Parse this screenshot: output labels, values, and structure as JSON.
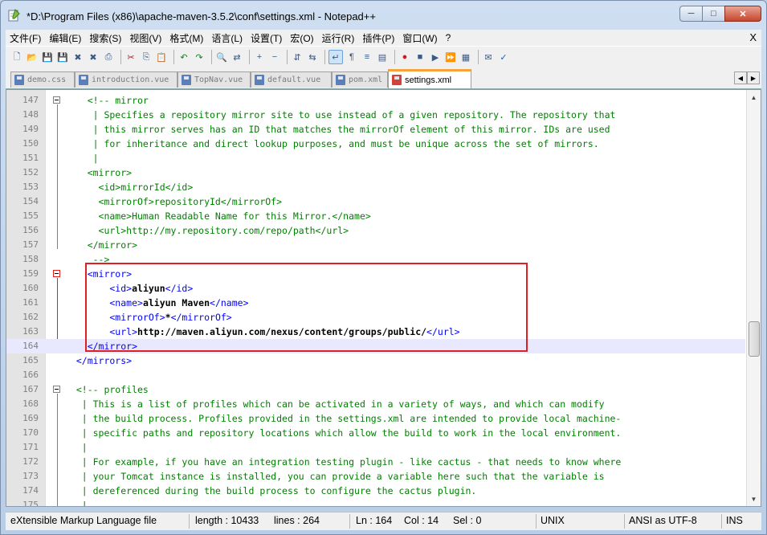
{
  "window": {
    "title": "*D:\\Program Files (x86)\\apache-maven-3.5.2\\conf\\settings.xml - Notepad++",
    "close_label": "X"
  },
  "menubar": {
    "items": [
      "文件(F)",
      "编辑(E)",
      "搜索(S)",
      "视图(V)",
      "格式(M)",
      "语言(L)",
      "设置(T)",
      "宏(O)",
      "运行(R)",
      "插件(P)",
      "窗口(W)",
      "?"
    ],
    "close_label": "X"
  },
  "toolbar": {
    "icons": [
      "new-file-icon",
      "open-file-icon",
      "save-icon",
      "save-all-icon",
      "close-icon",
      "close-all-icon",
      "print-icon",
      "cut-icon",
      "copy-icon",
      "paste-icon",
      "undo-icon",
      "redo-icon",
      "find-icon",
      "replace-icon",
      "zoom-in-icon",
      "zoom-out-icon",
      "sync-v-icon",
      "sync-h-icon",
      "word-wrap-icon",
      "show-all-chars-icon",
      "indent-guide-icon",
      "doc-map-icon",
      "record-macro-icon",
      "stop-macro-icon",
      "play-macro-icon",
      "run-macro-multiple-icon",
      "save-macro-icon",
      "launch-browser-icon",
      "spell-check-icon"
    ]
  },
  "tabs": [
    {
      "label": "demo.css",
      "active": false
    },
    {
      "label": "introduction.vue",
      "active": false
    },
    {
      "label": "TopNav.vue",
      "active": false
    },
    {
      "label": "default.vue",
      "active": false
    },
    {
      "label": "pom.xml",
      "active": false
    },
    {
      "label": "settings.xml",
      "active": true
    }
  ],
  "editor": {
    "current_line": "164",
    "lines": [
      {
        "n": "147",
        "segs": [
          {
            "t": "    <!-- mirror",
            "c": "cm"
          }
        ]
      },
      {
        "n": "148",
        "segs": [
          {
            "t": "     | Specifies a repository mirror site to use instead of a given repository. The repository that",
            "c": "cm"
          }
        ]
      },
      {
        "n": "149",
        "segs": [
          {
            "t": "     | this mirror serves has an ID that matches the mirrorOf element of this mirror. IDs are used",
            "c": "cm"
          }
        ]
      },
      {
        "n": "150",
        "segs": [
          {
            "t": "     | for inheritance and direct lookup purposes, and must be unique across the set of mirrors.",
            "c": "cm"
          }
        ]
      },
      {
        "n": "151",
        "segs": [
          {
            "t": "     |",
            "c": "cm"
          }
        ]
      },
      {
        "n": "152",
        "segs": [
          {
            "t": "    <mirror>",
            "c": "cm"
          }
        ]
      },
      {
        "n": "153",
        "segs": [
          {
            "t": "      <id>mirrorId</id>",
            "c": "cm"
          }
        ]
      },
      {
        "n": "154",
        "segs": [
          {
            "t": "      <mirrorOf>repositoryId</mirrorOf>",
            "c": "cm"
          }
        ]
      },
      {
        "n": "155",
        "segs": [
          {
            "t": "      <name>Human Readable Name for this Mirror.</name>",
            "c": "cm"
          }
        ]
      },
      {
        "n": "156",
        "segs": [
          {
            "t": "      <url>http://my.repository.com/repo/path</url>",
            "c": "cm"
          }
        ]
      },
      {
        "n": "157",
        "segs": [
          {
            "t": "    </mirror>",
            "c": "cm"
          }
        ]
      },
      {
        "n": "158",
        "segs": [
          {
            "t": "     -->",
            "c": "cm"
          }
        ]
      },
      {
        "n": "159",
        "segs": [
          {
            "t": "    <mirror>",
            "c": "tg"
          }
        ]
      },
      {
        "n": "160",
        "segs": [
          {
            "t": "        <id>",
            "c": "tg"
          },
          {
            "t": "aliyun",
            "c": "tx b"
          },
          {
            "t": "</id>",
            "c": "tg"
          }
        ]
      },
      {
        "n": "161",
        "segs": [
          {
            "t": "        <name>",
            "c": "tg"
          },
          {
            "t": "aliyun Maven",
            "c": "tx b"
          },
          {
            "t": "</name>",
            "c": "tg"
          }
        ]
      },
      {
        "n": "162",
        "segs": [
          {
            "t": "        <mirrorOf>",
            "c": "tg"
          },
          {
            "t": "*",
            "c": "tx b"
          },
          {
            "t": "</mirrorOf>",
            "c": "tg"
          }
        ]
      },
      {
        "n": "163",
        "segs": [
          {
            "t": "        <url>",
            "c": "tg"
          },
          {
            "t": "http://maven.aliyun.com/nexus/content/groups/public/",
            "c": "tx b"
          },
          {
            "t": "</url>",
            "c": "tg"
          }
        ]
      },
      {
        "n": "164",
        "segs": [
          {
            "t": "    </mirror>",
            "c": "tg"
          }
        ]
      },
      {
        "n": "165",
        "segs": [
          {
            "t": "  </mirrors>",
            "c": "tg"
          }
        ]
      },
      {
        "n": "166",
        "segs": [
          {
            "t": "",
            "c": "tx"
          }
        ]
      },
      {
        "n": "167",
        "segs": [
          {
            "t": "  <!-- profiles",
            "c": "cm"
          }
        ]
      },
      {
        "n": "168",
        "segs": [
          {
            "t": "   | This is a list of profiles which can be activated in a variety of ways, and which can modify",
            "c": "cm"
          }
        ]
      },
      {
        "n": "169",
        "segs": [
          {
            "t": "   | the build process. Profiles provided in the settings.xml are intended to provide local machine-",
            "c": "cm"
          }
        ]
      },
      {
        "n": "170",
        "segs": [
          {
            "t": "   | specific paths and repository locations which allow the build to work in the local environment.",
            "c": "cm"
          }
        ]
      },
      {
        "n": "171",
        "segs": [
          {
            "t": "   |",
            "c": "cm"
          }
        ]
      },
      {
        "n": "172",
        "segs": [
          {
            "t": "   | For example, if you have an integration testing plugin - like cactus - that needs to know where",
            "c": "cm"
          }
        ]
      },
      {
        "n": "173",
        "segs": [
          {
            "t": "   | your Tomcat instance is installed, you can provide a variable here such that the variable is",
            "c": "cm"
          }
        ]
      },
      {
        "n": "174",
        "segs": [
          {
            "t": "   | dereferenced during the build process to configure the cactus plugin.",
            "c": "cm"
          }
        ]
      },
      {
        "n": "175",
        "segs": [
          {
            "t": "   |",
            "c": "cm"
          }
        ]
      }
    ]
  },
  "statusbar": {
    "filetype": "eXtensible Markup Language file",
    "length": "length : 10433",
    "lines": "lines : 264",
    "ln": "Ln : 164",
    "col": "Col : 14",
    "sel": "Sel : 0",
    "eol": "UNIX",
    "encoding": "ANSI as UTF-8",
    "mode": "INS"
  }
}
